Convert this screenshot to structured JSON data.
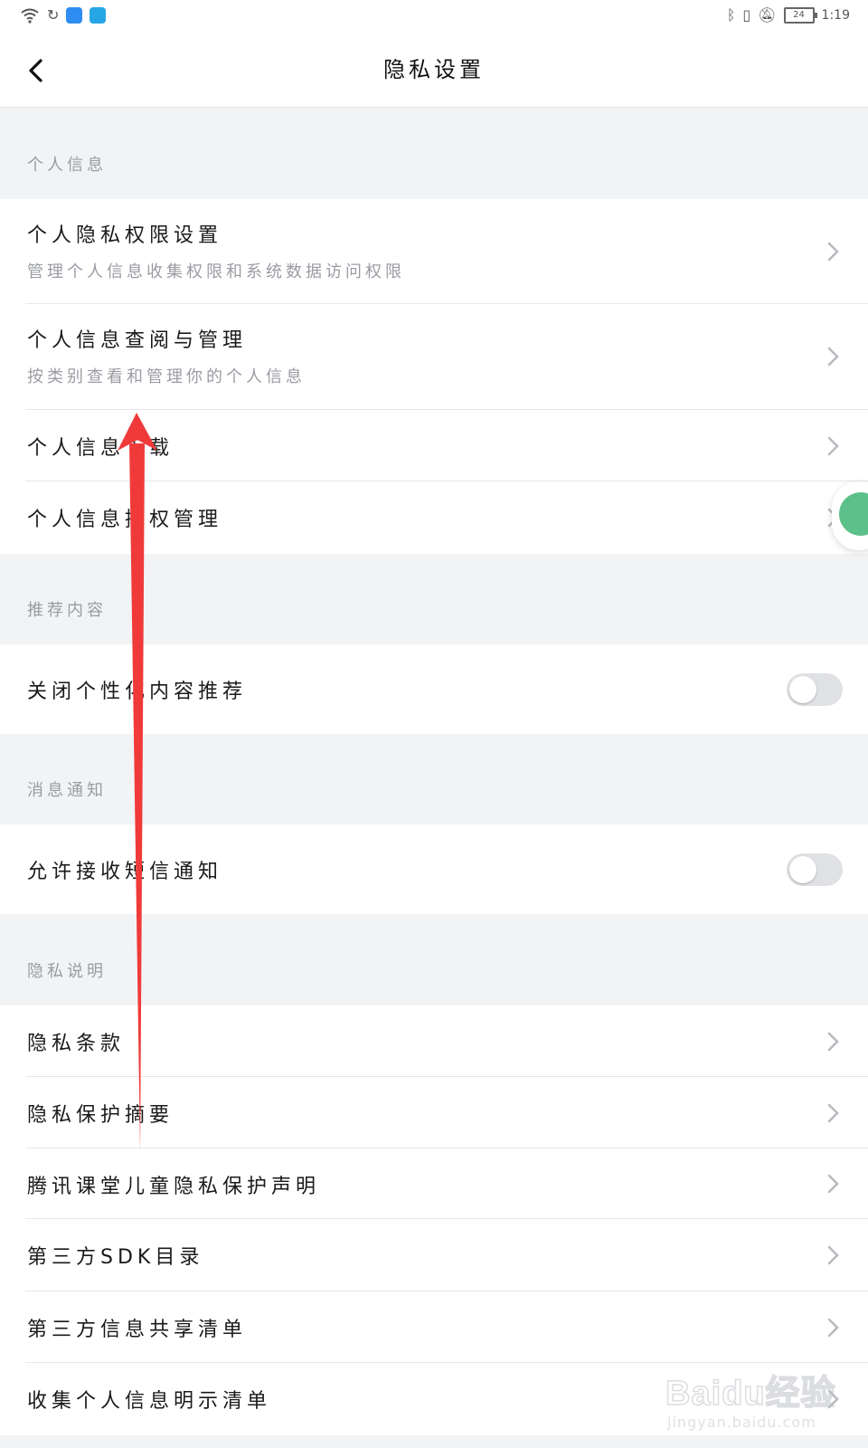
{
  "status_bar": {
    "time": "1:19",
    "battery": "24",
    "left_icons": [
      "wifi-icon",
      "sync-icon",
      "cloud-app-icon",
      "search-app-icon"
    ],
    "right_icons": [
      "bluetooth-icon",
      "vibrate-icon",
      "mute-icon",
      "battery-icon"
    ]
  },
  "nav": {
    "back_icon": "chevron-left-icon",
    "title": "隐私设置"
  },
  "sections": {
    "personal_info": {
      "header": "个人信息",
      "items": [
        {
          "title": "个人隐私权限设置",
          "subtitle": "管理个人信息收集权限和系统数据访问权限"
        },
        {
          "title": "个人信息查阅与管理",
          "subtitle": "按类别查看和管理你的个人信息"
        },
        {
          "title": "个人信息下载"
        },
        {
          "title": "个人信息授权管理"
        }
      ]
    },
    "recommend": {
      "header": "推荐内容",
      "items": [
        {
          "title": "关闭个性化内容推荐",
          "toggle": false
        }
      ]
    },
    "notify": {
      "header": "消息通知",
      "items": [
        {
          "title": "允许接收短信通知",
          "toggle": false
        }
      ]
    },
    "privacy_docs": {
      "header": "隐私说明",
      "items": [
        {
          "title": "隐私条款"
        },
        {
          "title": "隐私保护摘要"
        },
        {
          "title": "腾讯课堂儿童隐私保护声明"
        },
        {
          "title": "第三方SDK目录"
        },
        {
          "title": "第三方信息共享清单"
        },
        {
          "title": "收集个人信息明示清单"
        }
      ]
    }
  },
  "watermark": {
    "main": "Baidu经验",
    "sub": "jingyan.baidu.com"
  },
  "colors": {
    "page_bg": "#f2f3f5",
    "row_bg": "#ffffff",
    "annotation_arrow": "#f03a3a",
    "toggle_off": "#e0e1e4"
  }
}
